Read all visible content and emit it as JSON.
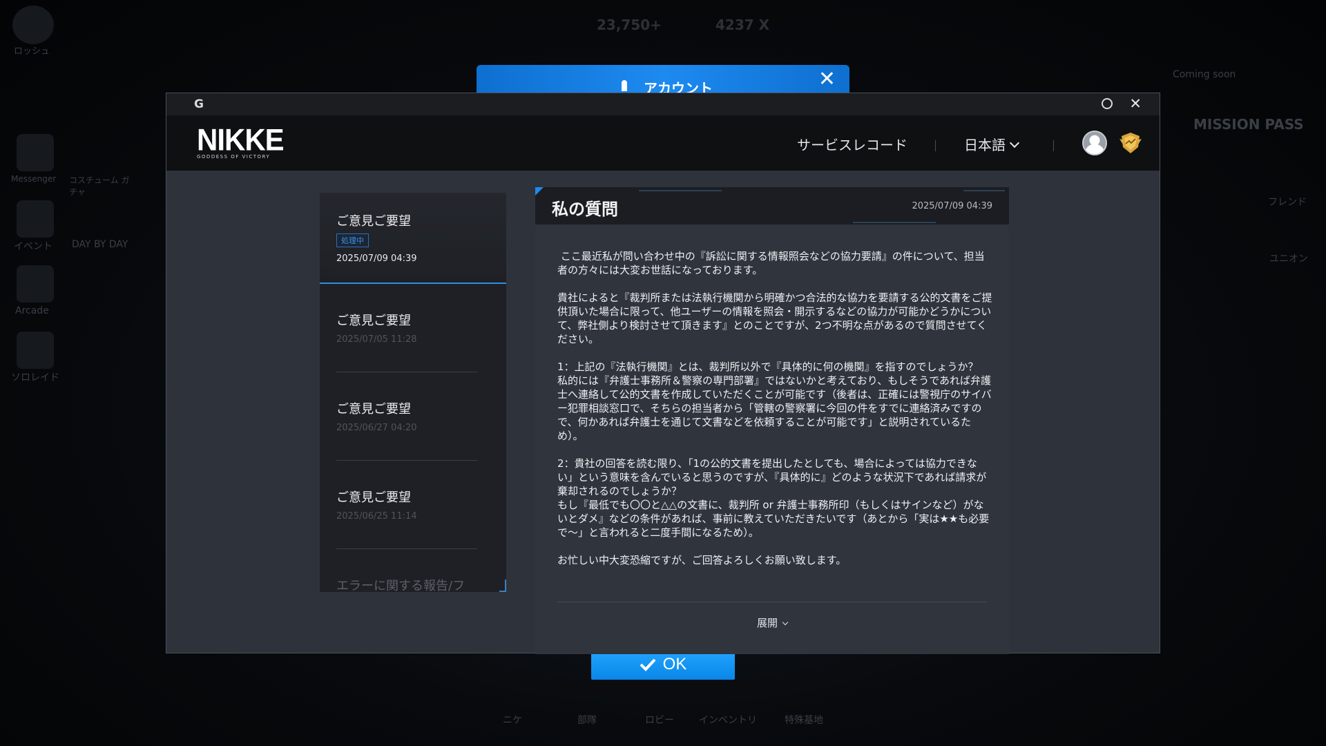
{
  "background": {
    "profile_name": "ロッシュ",
    "resource_1": "23,750+",
    "resource_2": "4237 X",
    "coming_soon": "Coming soon",
    "mission_pass": "MISSION PASS",
    "left_menu": [
      "Messenger",
      "コスチューム ガチャ",
      "イベント",
      "DAY BY DAY",
      "Arcade",
      "ソロレイド"
    ],
    "right_menu": [
      "フレンド",
      "ユニオン"
    ],
    "bottom_menu": [
      "ニケ",
      "部隊",
      "ロビー",
      "インベントリ",
      "特殊基地"
    ]
  },
  "account_dialog": {
    "title": "アカウント",
    "ok_label": "OK"
  },
  "window": {
    "titlebar_glyph": "G",
    "logo_main": "NIKKE",
    "logo_sub": "GODDESS OF VICTORY"
  },
  "nav": {
    "service_record": "サービスレコード",
    "language": "日本語"
  },
  "tickets": [
    {
      "title": "ご意見ご要望",
      "status": "処理中",
      "date": "2025/07/09 04:39"
    },
    {
      "title": "ご意見ご要望",
      "date": "2025/07/05 11:28"
    },
    {
      "title": "ご意見ご要望",
      "date": "2025/06/27 04:20"
    },
    {
      "title": "ご意見ご要望",
      "date": "2025/06/25 11:14"
    },
    {
      "title": "エラーに関する報告/フ"
    }
  ],
  "detail": {
    "title": "私の質問",
    "date": "2025/07/09 04:39",
    "paragraphs": [
      " ここ最近私が問い合わせ中の『訴訟に関する情報照会などの協力要請』の件について、担当者の方々には大変お世話になっております。",
      "貴社によると『裁判所または法執行機関から明確かつ合法的な協力を要請する公的文書をご提供頂いた場合に限って、他ユーザーの情報を照会・開示するなどの協力が可能かどうかについて、弊社側より検討させて頂きます』とのことですが、2つ不明な点があるので質問させてください。",
      "1：上記の『法執行機関』とは、裁判所以外で『具体的に何の機関』を指すのでしょうか？\n私的には『弁護士事務所＆警察の専門部署』ではないかと考えており、もしそうであれば弁護士へ連絡して公的文書を作成していただくことが可能です（後者は、正確には警視庁のサイバー犯罪相談窓口で、そちらの担当者から「管轄の警察署に今回の件をすでに連絡済みですので、何かあれば弁護士を通じて文書などを依頼することが可能です」と説明されているため）。",
      "2：貴社の回答を読む限り、「1の公的文書を提出したとしても、場合によっては協力できない」という意味を含んでいると思うのですが、『具体的に』どのような状況下であれば請求が棄却されるのでしょうか？\nもし『最低でも〇〇と△△の文書に、裁判所 or 弁護士事務所印（もしくはサインなど）がないとダメ』などの条件があれば、事前に教えていただきたいです（あとから「実は★★も必要で～」と言われると二度手間になるため）。",
      "お忙しい中大変恐縮ですが、ご回答よろしくお願い致します。"
    ],
    "expand_label": "展開"
  }
}
